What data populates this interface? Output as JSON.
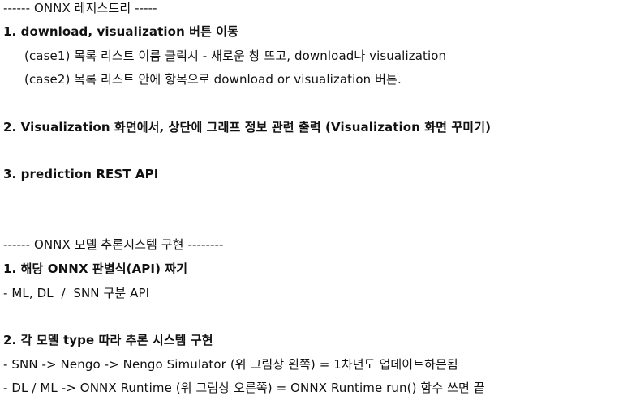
{
  "section1": {
    "header": "------ ONNX 레지스트리 -----",
    "item1": {
      "title": "1. download, visualization 버튼 이동",
      "case1": "(case1) 목록 리스트 이름 클릭시 - 새로운 창 뜨고, download나 visualization",
      "case2": "(case2) 목록 리스트 안에 항목으로 download or visualization 버튼."
    },
    "item2": "2. Visualization 화면에서, 상단에 그래프 정보 관련 출력 (Visualization 화면 꾸미기)",
    "item3": "3. prediction REST API"
  },
  "section2": {
    "header": "------ ONNX 모델 추론시스템 구현 --------",
    "item1": {
      "title": "1. 해당 ONNX 판별식(API) 짜기",
      "detail": "- ML, DL  /  SNN 구분 API"
    },
    "item2": {
      "title": "2. 각 모델 type 따라 추론 시스템 구현",
      "detail1": "- SNN -> Nengo -> Nengo Simulator (위 그림상 왼쪽) = 1차년도 업데이트하믄됨",
      "detail2": "- DL / ML -> ONNX Runtime (위 그림상 오른쪽) = ONNX Runtime run() 함수 쓰면 끝"
    }
  }
}
